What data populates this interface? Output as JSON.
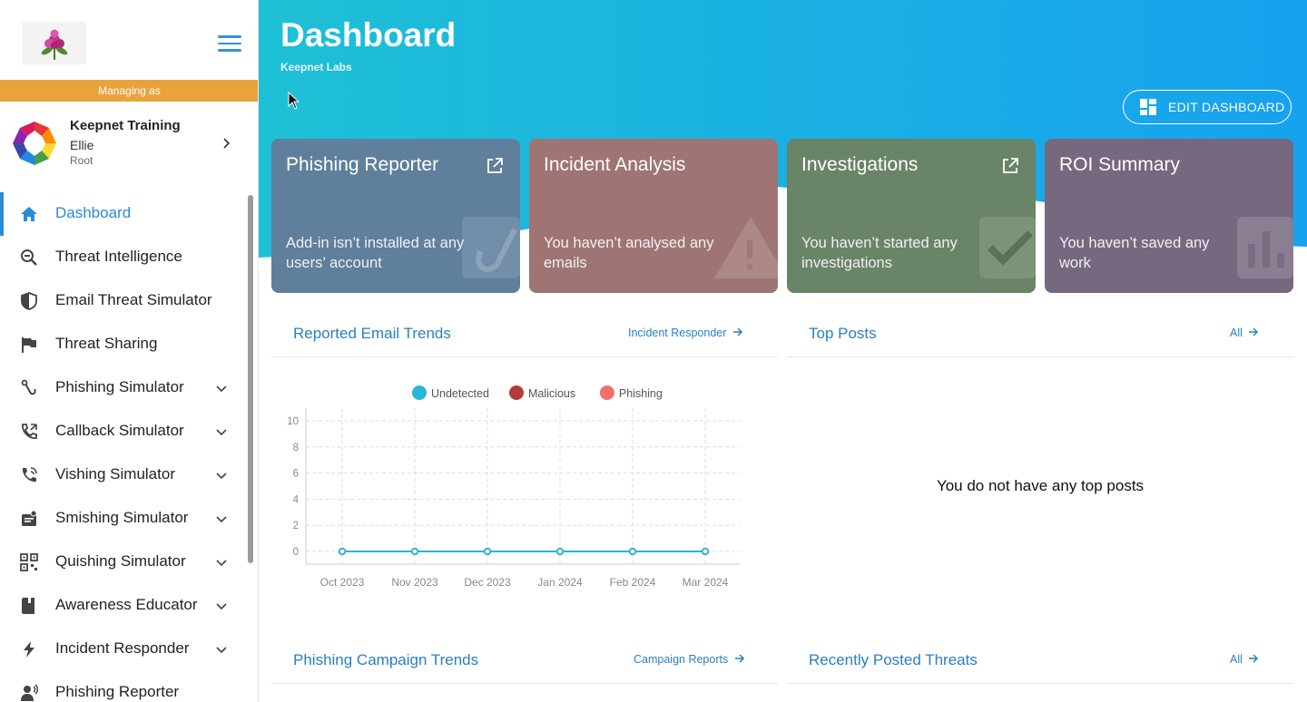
{
  "sidebar": {
    "managing_label": "Managing as",
    "account": {
      "org": "Keepnet Training",
      "user": "Ellie",
      "role": "Root"
    },
    "items": [
      {
        "label": "Dashboard",
        "icon": "home-icon",
        "active": true,
        "expandable": false
      },
      {
        "label": "Threat Intelligence",
        "icon": "search-threat-icon",
        "active": false,
        "expandable": false
      },
      {
        "label": "Email Threat Simulator",
        "icon": "shield-icon",
        "active": false,
        "expandable": false
      },
      {
        "label": "Threat Sharing",
        "icon": "flag-icon",
        "active": false,
        "expandable": false
      },
      {
        "label": "Phishing Simulator",
        "icon": "hook-icon",
        "active": false,
        "expandable": true
      },
      {
        "label": "Callback Simulator",
        "icon": "phone-callback-icon",
        "active": false,
        "expandable": true
      },
      {
        "label": "Vishing Simulator",
        "icon": "phone-icon",
        "active": false,
        "expandable": true
      },
      {
        "label": "Smishing Simulator",
        "icon": "sms-icon",
        "active": false,
        "expandable": true
      },
      {
        "label": "Quishing Simulator",
        "icon": "qr-code-icon",
        "active": false,
        "expandable": true
      },
      {
        "label": "Awareness Educator",
        "icon": "book-icon",
        "active": false,
        "expandable": true
      },
      {
        "label": "Incident Responder",
        "icon": "lightning-icon",
        "active": false,
        "expandable": true
      },
      {
        "label": "Phishing Reporter",
        "icon": "reporter-icon",
        "active": false,
        "expandable": false
      }
    ]
  },
  "header": {
    "title": "Dashboard",
    "subtitle": "Keepnet Labs",
    "edit_button": "EDIT DASHBOARD"
  },
  "cards": [
    {
      "title": "Phishing Reporter",
      "desc": "Add-in isn’t installed at any users’ account",
      "color": "#5f7f9c",
      "external": true,
      "icon": "hook-icon"
    },
    {
      "title": "Incident Analysis",
      "desc": "You haven’t analysed any emails",
      "color": "#9e7574",
      "external": false,
      "icon": "warning-icon"
    },
    {
      "title": "Investigations",
      "desc": "You haven’t started any investigations",
      "color": "#6a8467",
      "external": true,
      "icon": "checkmark-icon"
    },
    {
      "title": "ROI Summary",
      "desc": "You haven’t saved any work",
      "color": "#76687f",
      "external": false,
      "icon": "bar-chart-icon"
    }
  ],
  "panels": {
    "reported_trends": {
      "title": "Reported Email Trends",
      "link": "Incident Responder"
    },
    "top_posts": {
      "title": "Top Posts",
      "link": "All",
      "empty": "You do not have any top posts"
    },
    "campaign_trends": {
      "title": "Phishing Campaign Trends",
      "link": "Campaign Reports"
    },
    "recent_threats": {
      "title": "Recently Posted Threats",
      "link": "All"
    }
  },
  "chart_data": {
    "type": "line",
    "x": [
      "Oct 2023",
      "Nov 2023",
      "Dec 2023",
      "Jan 2024",
      "Feb 2024",
      "Mar 2024"
    ],
    "series": [
      {
        "name": "Undetected",
        "color": "#29b6d6",
        "values": [
          0,
          0,
          0,
          0,
          0,
          0
        ]
      },
      {
        "name": "Malicious",
        "color": "#b53a3a",
        "values": [
          0,
          0,
          0,
          0,
          0,
          0
        ]
      },
      {
        "name": "Phishing",
        "color": "#f07070",
        "values": [
          0,
          0,
          0,
          0,
          0,
          0
        ]
      }
    ],
    "ylim": [
      0,
      10
    ],
    "yticks": [
      0,
      2,
      4,
      6,
      8,
      10
    ],
    "grid": true,
    "legend": "top"
  },
  "colors": {
    "accent": "#2a8ad6",
    "managing_bar": "#e8a33d",
    "hero_start": "#1ec0d6",
    "hero_end": "#16a2ee"
  }
}
